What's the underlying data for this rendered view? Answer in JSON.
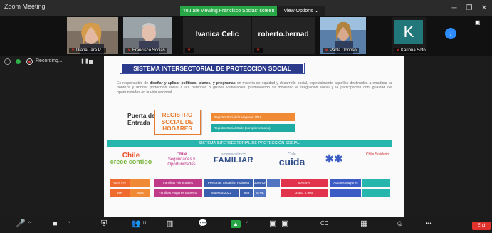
{
  "window": {
    "title": "Zoom Meeting",
    "share_banner": "You are viewing Francisco Socias' screen",
    "view_options": "View Options",
    "chevron": "⌄",
    "minimize_glyph": "─",
    "maximize_glyph": "❐",
    "close_glyph": "✕"
  },
  "participants": [
    {
      "name": "Diana Jara P..."
    },
    {
      "name": "Francisco Socias"
    },
    {
      "name": "Ivanica Celic"
    },
    {
      "name": "roberto.bernad"
    },
    {
      "name": "Paola Donoso"
    },
    {
      "name": "Karinna Soto",
      "initial": "K"
    }
  ],
  "strip": {
    "next_glyph": "›",
    "view_glyph": "▣"
  },
  "recording": {
    "label": "Recording...",
    "pause_glyph": "❚❚"
  },
  "slide": {
    "title": "SISTEMA INTERSECTORIAL DE PROTECCION SOCIAL",
    "para_prefix": "Es responsable de ",
    "para_bold": "diseñar y aplicar políticas, planes, y programas",
    "para_rest": " en materia de equidad y desarrollo social, especialmente aquellos destinados a erradicar la pobreza y brindar protección social a las personas o grupos vulnerables, promoviendo su movilidad e integración social y la participación con igualdad de oportunidades en la vida nacional.",
    "puerta": "Puerta de Entrada",
    "rsh_l1": "REGISTRO",
    "rsh_l2": "SOCIAL DE",
    "rsh_l3": "HOGARES",
    "registro_a": "Registro Social de Hogares 2016",
    "registro_b": "Registro Social Calle (complementaria)",
    "sis_bar": "SISTEMA INTERSECTORIAL DE PROTECCIÓN SOCIAL",
    "logos": {
      "crece_l1": "Chile",
      "crece_l2": "crece contigo",
      "opp_l1": "Chile",
      "opp_l2": "Seguridades y Oportunidades",
      "familiar_l1": "INGRESO ÉTICO",
      "familiar_l2": "FAMILIAR",
      "cuida_l1": "Chile",
      "cuida_l2": "cuida",
      "people": "✱✱",
      "chsol": "Chile Solidario"
    },
    "stats_row1": {
      "crece_a": "60% 4%",
      "crece_b": "",
      "opp": "Familias vulnerables",
      "fam_a": "Personas Situación Pobreza",
      "fam_b": "30% 92%",
      "fam_c": "",
      "cuida": "60% 4%",
      "peo": "Adultos Mayores",
      "chsol": ""
    },
    "stats_row2": {
      "crece_a": "95K",
      "crece_b": "280K",
      "opp": "Familias Hogares Extrema",
      "fam_a": "Muestra 2022",
      "fam_b": "963",
      "fam_c": "870K",
      "cuida": "3.451 2.900",
      "peo": "",
      "chsol": ""
    }
  },
  "toolbar": {
    "mute_glyph": "🎤",
    "video_glyph": "■",
    "security_glyph": "⛨",
    "participants_glyph": "👥",
    "participants_count": "11",
    "chat_glyph": "💬",
    "polls_glyph": "▥",
    "share_glyph": "▲",
    "record_glyph": "▣",
    "cc_glyph": "CC",
    "apps_glyph": "▦",
    "reactions_glyph": "☺",
    "more_glyph": "•••",
    "end_label": "End"
  }
}
